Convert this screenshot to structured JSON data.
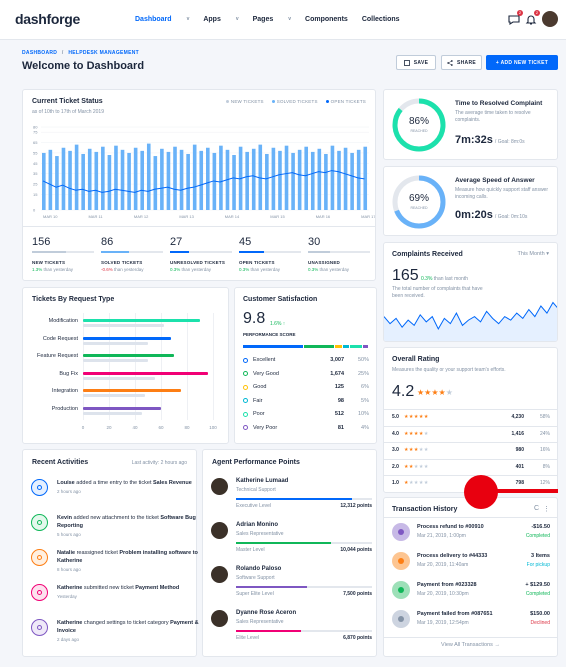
{
  "nav": {
    "logo_a": "dash",
    "logo_b": "forge",
    "items": [
      {
        "label": "Dashboard",
        "caret": "v"
      },
      {
        "label": "Apps",
        "caret": "v"
      },
      {
        "label": "Pages",
        "caret": "v"
      },
      {
        "label": "Components",
        "caret": ""
      },
      {
        "label": "Collections",
        "caret": ""
      }
    ],
    "messages_count": "2",
    "notif_count": "2"
  },
  "header": {
    "crumb_root": "DASHBOARD",
    "crumb_sep": "/",
    "crumb_current": "HELPDESK MANAGEMENT",
    "title": "Welcome to Dashboard",
    "save": "SAVE",
    "share": "SHARE",
    "add": "+ ADD NEW TICKET"
  },
  "ticket_status": {
    "title": "Current Ticket Status",
    "subtitle": "as of 10th to 17th of March 2019",
    "legend": [
      "NEW TICKETS",
      "SOLVED TICKETS",
      "OPEN TICKETS"
    ],
    "colors": {
      "new": "#c0ccda",
      "solved": "#69b2f8",
      "open": "#0168fa"
    }
  },
  "chart_data": {
    "type": "bar",
    "x": [
      "MAR 10",
      "MAR 11",
      "MAR 12",
      "MAR 13",
      "MAR 14",
      "MAR 15",
      "MAR 16",
      "MAR 17"
    ],
    "ylim": [
      0,
      80
    ],
    "yticks": [
      0,
      15,
      25,
      35,
      45,
      55,
      65,
      75,
      80
    ],
    "series": [
      {
        "name": "SOLVED TICKETS",
        "values": [
          55,
          58,
          52,
          60,
          57,
          63,
          54,
          59,
          56,
          61,
          53,
          62,
          58,
          55,
          60,
          57,
          64,
          52,
          59,
          56,
          61,
          58,
          54,
          63,
          57,
          60,
          55,
          62,
          58,
          53,
          61,
          56,
          59,
          63,
          54,
          60,
          57,
          62,
          55,
          58,
          61,
          56,
          59,
          54,
          62,
          57,
          60,
          55,
          58,
          61
        ]
      },
      {
        "name": "OPEN TICKETS",
        "values": [
          28,
          25,
          22,
          24,
          21,
          19,
          20,
          18,
          19,
          17,
          18,
          20,
          19,
          18,
          17,
          19,
          18,
          20,
          21,
          22,
          20,
          19,
          21,
          22,
          24,
          26,
          28,
          27,
          29,
          31,
          30,
          32,
          33,
          31,
          30,
          32,
          34,
          35,
          36,
          34,
          33,
          35,
          37,
          36,
          38,
          37,
          35,
          33,
          31,
          30
        ]
      }
    ]
  },
  "stats": [
    {
      "value": "156",
      "label": "NEW TICKETS",
      "change": "1.3%",
      "dir": "up",
      "suffix": "than yesterday",
      "fill": 0.55,
      "color": "#c0ccda"
    },
    {
      "value": "86",
      "label": "SOLVED TICKETS",
      "change": "-0.6%",
      "dir": "dn",
      "suffix": "than yesterday",
      "fill": 0.45,
      "color": "#69b2f8"
    },
    {
      "value": "27",
      "label": "UNRESOLVED TICKETS",
      "change": "0.3%",
      "dir": "up",
      "suffix": "than yesterday",
      "fill": 0.3,
      "color": "#0168fa"
    },
    {
      "value": "45",
      "label": "OPEN TICKETS",
      "change": "0.3%",
      "dir": "up",
      "suffix": "than yesterday",
      "fill": 0.4,
      "color": "#0168fa"
    },
    {
      "value": "30",
      "label": "UNASSIGNED",
      "change": "0.3%",
      "dir": "up",
      "suffix": "than yesterday",
      "fill": 0.35,
      "color": "#c0ccda"
    }
  ],
  "resolved": {
    "pct": "86%",
    "reached": "REACHED",
    "value": 0.86,
    "title": "Time to Resolved Complaint",
    "desc": "The average time taken to resolve complaints.",
    "time": "7m:32s",
    "goal": "/ Goal: 8m:0s"
  },
  "speed": {
    "pct": "69%",
    "reached": "REACHED",
    "value": 0.69,
    "title": "Average Speed of Answer",
    "desc": "Measure how quickly support staff answer incoming calls.",
    "time": "0m:20s",
    "goal": "/ Goal: 0m:10s"
  },
  "complaints": {
    "title": "Complaints Received",
    "period": "This Month",
    "value": "165",
    "change": "0.3%",
    "suffix": "than last month",
    "desc": "The total number of complaints that have been received.",
    "series": [
      30,
      22,
      28,
      18,
      26,
      20,
      32,
      24,
      30,
      16,
      28,
      22,
      34,
      20,
      26,
      30,
      24,
      36,
      28,
      22,
      30,
      26,
      34,
      28,
      38,
      30,
      42,
      34,
      46,
      38
    ]
  },
  "request_type": {
    "title": "Tickets By Request Type",
    "categories": [
      "Modification",
      "Code Request",
      "Feature Request",
      "Bug Fix",
      "Integration",
      "Production"
    ],
    "ticks": [
      "0",
      "20",
      "40",
      "60",
      "80",
      "100"
    ],
    "xlim": [
      0,
      100
    ],
    "colors": [
      "#1ce1ac",
      "#0168fa",
      "#10b759",
      "#f10075",
      "#fd7e14",
      "#7e57c2"
    ],
    "values": [
      90,
      68,
      70,
      96,
      75,
      60
    ],
    "values_b": [
      62,
      50,
      50,
      55,
      48,
      45
    ]
  },
  "csat": {
    "title": "Customer Satisfaction",
    "score": "9.8",
    "change": "1.6%",
    "label": "PERFORMANCE SCORE",
    "rows": [
      {
        "label": "Excellent",
        "count": "3,007",
        "pct": "50%",
        "color": "#0168fa"
      },
      {
        "label": "Very Good",
        "count": "1,674",
        "pct": "25%",
        "color": "#10b759"
      },
      {
        "label": "Good",
        "count": "125",
        "pct": "6%",
        "color": "#ffc107"
      },
      {
        "label": "Fair",
        "count": "98",
        "pct": "5%",
        "color": "#00b8d4"
      },
      {
        "label": "Poor",
        "count": "512",
        "pct": "10%",
        "color": "#1ce1ac"
      },
      {
        "label": "Very Poor",
        "count": "81",
        "pct": "4%",
        "color": "#7e57c2"
      }
    ]
  },
  "rating": {
    "title": "Overall Rating",
    "desc": "Measures the quality or your support team's efforts.",
    "score": "4.2",
    "rows": [
      {
        "label": "5.0",
        "stars": 5,
        "count": "4,230",
        "pct": "58%"
      },
      {
        "label": "4.0",
        "stars": 4,
        "count": "1,416",
        "pct": "24%"
      },
      {
        "label": "3.0",
        "stars": 3,
        "count": "980",
        "pct": "16%"
      },
      {
        "label": "2.0",
        "stars": 2,
        "count": "401",
        "pct": "8%"
      },
      {
        "label": "1.0",
        "stars": 1,
        "count": "798",
        "pct": "12%"
      }
    ]
  },
  "activities": {
    "title": "Recent Activities",
    "last": "Last activity: 2 hours ago",
    "items": [
      {
        "who": "Louise",
        "text": " added a time entry to the ticket ",
        "obj": "Sales Revenue",
        "time": "2 hours ago",
        "color": "#0168fa",
        "bg": "#e5f0ff",
        "icon": "clock-icon"
      },
      {
        "who": "Kevin",
        "text": " added new attachment to the ticket ",
        "obj": "Software Bug Reporting",
        "time": "5 hours ago",
        "color": "#10b759",
        "bg": "#e3f8ec",
        "icon": "paperclip-icon"
      },
      {
        "who": "Natalie",
        "text": " reassigned ticket ",
        "obj": "Problem installing software to Katherine",
        "time": "8 hours ago",
        "color": "#fd7e14",
        "bg": "#fff0e1",
        "icon": "share-icon"
      },
      {
        "who": "Katherine",
        "text": " submitted new ticket ",
        "obj": "Payment Method",
        "time": "Yesterday",
        "color": "#f10075",
        "bg": "#fde1ee",
        "icon": "plus-circle-icon"
      },
      {
        "who": "Katherine",
        "text": " changed settings to ticket category ",
        "obj": "Payment & Invoice",
        "time": "2 days ago",
        "color": "#7e57c2",
        "bg": "#efe9f8",
        "icon": "gear-icon"
      }
    ]
  },
  "agents": {
    "title": "Agent Performance Points",
    "items": [
      {
        "name": "Katherine Lumaad",
        "role": "Technical Support",
        "level": "Executive Level",
        "points": "12,312 points",
        "fill": 0.85,
        "color": "#0168fa"
      },
      {
        "name": "Adrian Monino",
        "role": "Sales Representative",
        "level": "Master Level",
        "points": "10,044 points",
        "fill": 0.7,
        "color": "#10b759"
      },
      {
        "name": "Rolando Paloso",
        "role": "Software Support",
        "level": "Super Elite Level",
        "points": "7,500 points",
        "fill": 0.52,
        "color": "#7e57c2"
      },
      {
        "name": "Dyanne Rose Aceron",
        "role": "Sales Representative",
        "level": "Elite Level",
        "points": "6,870 points",
        "fill": 0.48,
        "color": "#f10075"
      }
    ]
  },
  "transactions": {
    "title": "Transaction History",
    "refresh": "C",
    "more": "⋮",
    "items": [
      {
        "title": "Process refund to #00910",
        "date": "Mar 21, 2019, 1:00pm",
        "amount": "-$16.50",
        "status": "Completed",
        "color": "#7e57c2",
        "bg": "#c7b9e6",
        "st_color": "#10b759",
        "icon": "undo-icon"
      },
      {
        "title": "Process delivery to #44333",
        "date": "Mar 20, 2019, 11:40am",
        "amount": "3 Items",
        "status": "For pickup",
        "color": "#fd7e14",
        "bg": "#fdc591",
        "st_color": "#00b8d4",
        "icon": "truck-icon"
      },
      {
        "title": "Payment from #023328",
        "date": "Mar 20, 2019, 10:30pm",
        "amount": "+ $129.50",
        "status": "Completed",
        "color": "#10b759",
        "bg": "#9de0b8",
        "st_color": "#10b759",
        "icon": "check-icon"
      },
      {
        "title": "Payment failed from #087651",
        "date": "Mar 19, 2019, 12:54pm",
        "amount": "$150.00",
        "status": "Declined",
        "color": "#8392a5",
        "bg": "#cdd4e0",
        "st_color": "#dc3545",
        "icon": "x-icon"
      }
    ],
    "view_all": "View All Transactions →"
  }
}
